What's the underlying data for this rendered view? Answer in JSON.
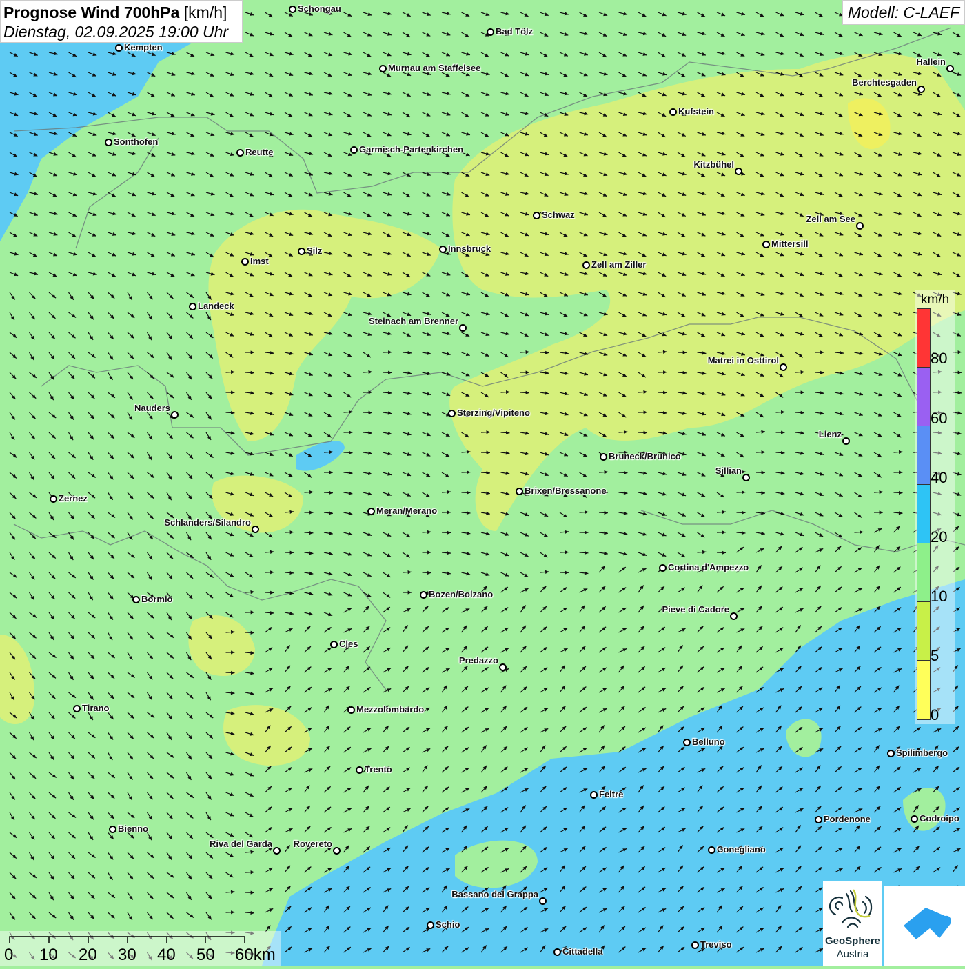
{
  "header": {
    "title": "Prognose Wind 700hPa",
    "unit": "[km/h]",
    "datetime": "Dienstag, 02.09.2025 19:00 Uhr",
    "model": "Modell: C-LAEF"
  },
  "legend": {
    "unit": "km/h",
    "colors": [
      "#ff3535",
      "#9a60f2",
      "#5a8ff5",
      "#2ec4f5",
      "#8ef08a",
      "#c8f048",
      "#ffff5a"
    ],
    "labels": [
      "80",
      "60",
      "40",
      "20",
      "10",
      "5",
      "0"
    ]
  },
  "scale_bar": {
    "labels": [
      "0",
      "10",
      "20",
      "30",
      "40",
      "50",
      "60km"
    ]
  },
  "cities": [
    "Schongau",
    "Bad Tölz",
    "Kempten",
    "Murnau am Staffelsee",
    "Hallein",
    "Berchtesgaden",
    "Kufstein",
    "Sonthofen",
    "Reutte",
    "Garmisch-Partenkirchen",
    "Kitzbühel",
    "Schwaz",
    "Zell am See",
    "Mittersill",
    "Innsbruck",
    "Imst",
    "Silz",
    "Zell am Ziller",
    "Landeck",
    "Steinach am Brenner",
    "Matrei in Osttirol",
    "Nauders",
    "Sterzing/Vipiteno",
    "Lienz",
    "Bruneck/Brunico",
    "Sillian",
    "Brixen/Bressanone",
    "Zernez",
    "Meran/Merano",
    "Schlanders/Silandro",
    "Cortina d'Ampezzo",
    "Bozen/Bolzano",
    "Bormio",
    "Pieve di Cadore",
    "Cles",
    "Predazzo",
    "Tirano",
    "Mezzolombardo",
    "Belluno",
    "Spilimbergo",
    "Trento",
    "Feltre",
    "Pordenone",
    "Codroipo",
    "Bienno",
    "Riva del Garda",
    "Rovereto",
    "Conegliano",
    "Bassano del Grappa",
    "Schio",
    "Treviso",
    "Cittadella"
  ],
  "logos": {
    "geosphere_line1": "GeoSphere",
    "geosphere_line2": "Austria"
  },
  "colors": {
    "area_green": "#a2ef9e",
    "area_yellowgreen": "#d6f07c",
    "area_cyan": "#5ecbf3"
  }
}
